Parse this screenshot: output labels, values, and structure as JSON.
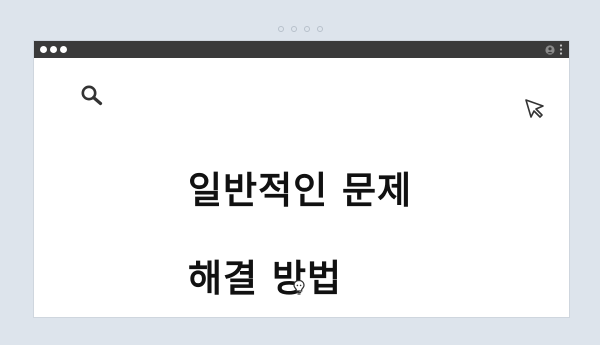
{
  "window": {
    "traffic_lights": [
      "close-dot",
      "minimize-dot",
      "zoom-dot"
    ],
    "toolbar_icons": [
      "user-icon",
      "vertical-ellipsis-icon"
    ]
  },
  "main": {
    "title_lines": [
      "일반적인 문제",
      "해결 방법"
    ],
    "icons": [
      "search-icon",
      "cursor-icon",
      "lightbulb-icon"
    ]
  },
  "colors": {
    "background": "#dde4ec",
    "titlebar": "#3a3a3a",
    "card": "#ffffff",
    "text": "#111111"
  }
}
